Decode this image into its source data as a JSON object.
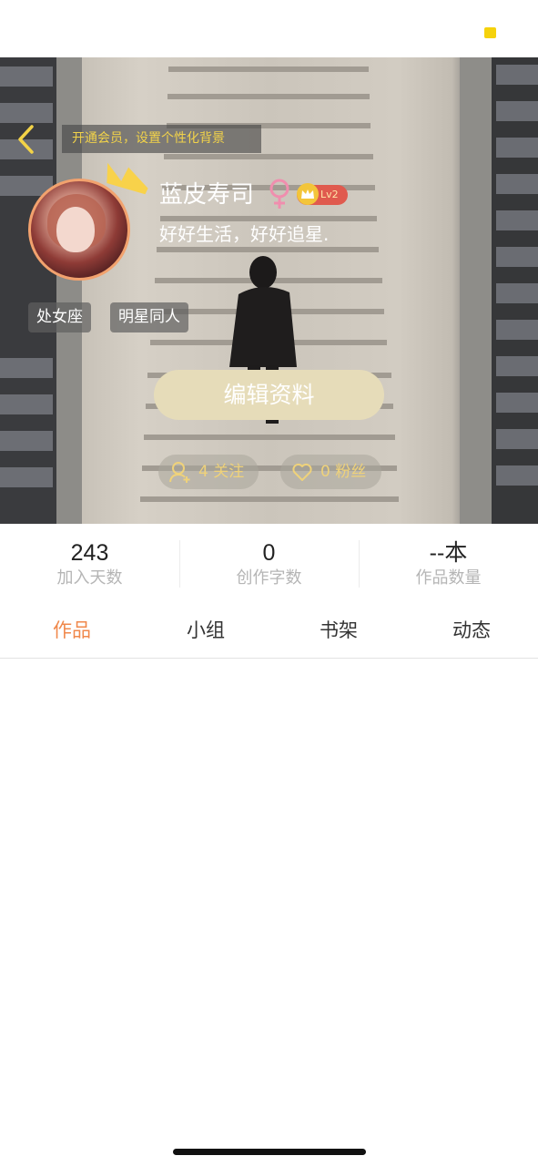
{
  "status_bar": {
    "indicator_color": "#f5d20c"
  },
  "header": {
    "back_icon": "chevron-left-icon",
    "vip_banner": "开通会员，设置个性化背景"
  },
  "profile": {
    "username": "蓝皮寿司",
    "gender_icon": "female-icon",
    "level": "Lv2",
    "signature": "好好生活，好好追星.",
    "tags": [
      "处女座",
      "明星同人"
    ],
    "edit_button": "编辑资料",
    "follow": {
      "icon": "add-user-icon",
      "label": "4 关注"
    },
    "fans": {
      "icon": "heart-icon",
      "label": "0 粉丝"
    }
  },
  "stats": [
    {
      "value": "243",
      "label": "加入天数"
    },
    {
      "value": "0",
      "label": "创作字数"
    },
    {
      "value": "--本",
      "label": "作品数量"
    }
  ],
  "tabs": [
    {
      "label": "作品",
      "active": true
    },
    {
      "label": "小组",
      "active": false
    },
    {
      "label": "书架",
      "active": false
    },
    {
      "label": "动态",
      "active": false
    }
  ],
  "colors": {
    "accent": "#f0884b",
    "gold": "#f1d24a",
    "edit_button": "#e6dcb9"
  }
}
